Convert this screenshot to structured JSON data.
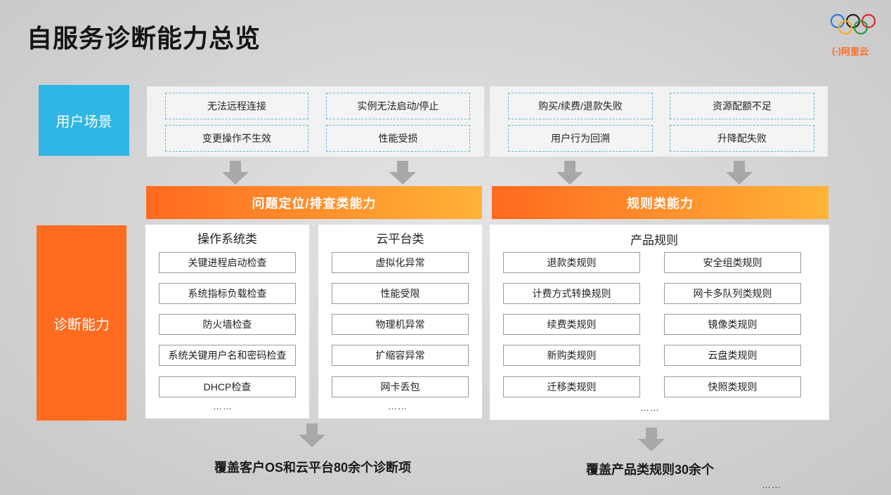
{
  "title": "自服务诊断能力总览",
  "logo": {
    "brand": "阿里云",
    "icon": "olympic-rings-icon"
  },
  "labels": {
    "scenarios": "用户场景",
    "capabilities": "诊断能力"
  },
  "scenarios": [
    "无法远程连接",
    "实例无法启动/停止",
    "购买/续费/退款失败",
    "资源配额不足",
    "变更操作不生效",
    "性能受损",
    "用户行为回溯",
    "升降配失败"
  ],
  "banners": {
    "left": "问题定位/排查类能力",
    "right": "规则类能力"
  },
  "os": {
    "title": "操作系统类",
    "items": [
      "关键进程启动检查",
      "系统指标负载检查",
      "防火墙检查",
      "系统关键用户名和密码检查",
      "DHCP检查"
    ],
    "more": "……"
  },
  "cloud": {
    "title": "云平台类",
    "items": [
      "虚拟化异常",
      "性能受限",
      "物理机异常",
      "扩缩容异常",
      "网卡丢包"
    ],
    "more": "……"
  },
  "product": {
    "title": "产品规则",
    "items": [
      "退款类规则",
      "安全组类规则",
      "计费方式转换规则",
      "网卡多队列类规则",
      "续费类规则",
      "镜像类规则",
      "新购类规则",
      "云盘类规则",
      "迁移类规则",
      "快照类规则"
    ],
    "more": "……"
  },
  "summaries": {
    "left": "覆盖客户OS和云平台80余个诊断项",
    "right": "覆盖产品类规则30余个",
    "more": "……"
  }
}
